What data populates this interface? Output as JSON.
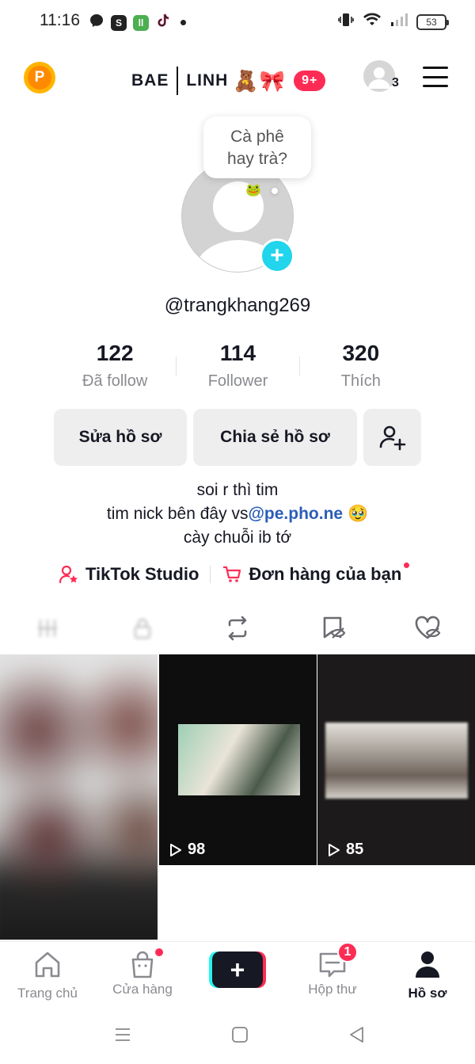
{
  "status_bar": {
    "time": "11:16",
    "battery": "53"
  },
  "header": {
    "coin_label": "P",
    "name_part1": "BAE",
    "name_part2": "LINH",
    "emojis": "🧸🎀",
    "notif_badge": "9+",
    "switch_account_count": "3"
  },
  "profile": {
    "bubble_text_line1": "Cà phê",
    "bubble_text_line2": "hay trà?",
    "bubble_emoji": "🐸",
    "username": "@trangkhang269"
  },
  "stats": [
    {
      "value": "122",
      "label": "Đã follow"
    },
    {
      "value": "114",
      "label": "Follower"
    },
    {
      "value": "320",
      "label": "Thích"
    }
  ],
  "actions": {
    "edit_profile": "Sửa hồ sơ",
    "share_profile": "Chia sẻ hồ sơ"
  },
  "bio": {
    "line1": "soi r thì tim",
    "line2_prefix": "tim nick bên đây vs",
    "line2_mention": "@pe.pho.ne",
    "line2_emoji": "🥹",
    "line3": "cày chuỗi ib tớ"
  },
  "links": {
    "studio": "TikTok Studio",
    "orders": "Đơn hàng của bạn"
  },
  "videos": [
    {
      "views": ""
    },
    {
      "views": "98"
    },
    {
      "views": "85"
    }
  ],
  "bottom_nav": {
    "home": "Trang chủ",
    "shop": "Cửa hàng",
    "inbox": "Hộp thư",
    "inbox_badge": "1",
    "profile": "Hồ sơ"
  },
  "colors": {
    "accent_red": "#fe2c55",
    "accent_cyan": "#25f4ee",
    "mention_blue": "#2b5db9",
    "text_primary": "#161823",
    "text_secondary": "#8a8b91"
  }
}
